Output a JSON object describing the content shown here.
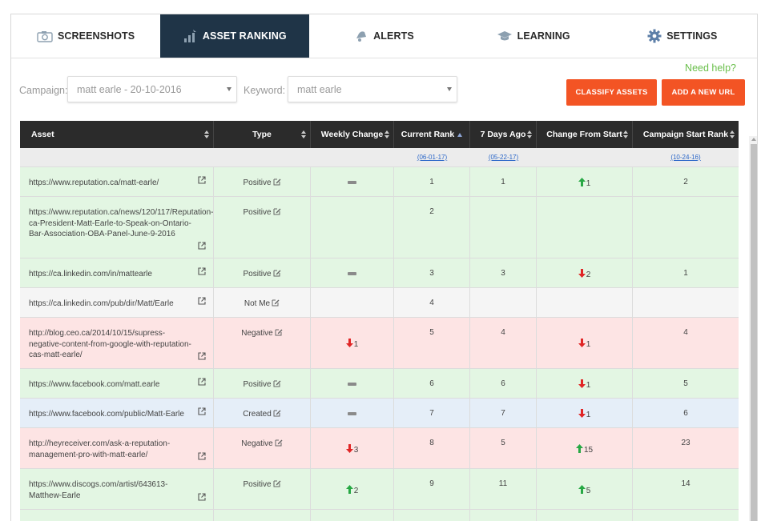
{
  "tabs": [
    {
      "label": "SCREENSHOTS",
      "icon": "camera-icon",
      "active": false
    },
    {
      "label": "ASSET RANKING",
      "icon": "bar-chart-icon",
      "active": true
    },
    {
      "label": "ALERTS",
      "icon": "bell-icon",
      "active": false
    },
    {
      "label": "LEARNING",
      "icon": "graduation-cap-icon",
      "active": false
    },
    {
      "label": "SETTINGS",
      "icon": "gear-icon",
      "active": false
    }
  ],
  "help": "Need help?",
  "filters": {
    "campaign_label": "Campaign:",
    "campaign_value": "matt earle - 20-10-2016",
    "keyword_label": "Keyword:",
    "keyword_value": "matt earle"
  },
  "buttons": {
    "classify": "CLASSIFY ASSETS",
    "add_url": "ADD A NEW URL"
  },
  "colors": {
    "accent": "#f35424",
    "nav_active": "#1f3447",
    "positive_row": "#e3f6e3",
    "negative_row": "#fde4e4",
    "neutral_row": "#f5f5f5",
    "created_row": "#e5eef8",
    "up_arrow": "#27a844",
    "down_arrow": "#e02626"
  },
  "table": {
    "headers": {
      "asset": "Asset",
      "type": "Type",
      "weekly": "Weekly Change",
      "current": "Current Rank",
      "seven": "7 Days Ago",
      "change_start": "Change From Start",
      "start_rank": "Campaign Start Rank"
    },
    "dates": {
      "current": "(06-01-17)",
      "seven": "(05-22-17)",
      "start": "(10-24-16)"
    },
    "rows": [
      {
        "url": "https://www.reputation.ca/matt-earle/",
        "type": "Positive",
        "cls": "positive",
        "h": 37,
        "weekly": {
          "kind": "dash"
        },
        "current": "1",
        "seven": "1",
        "change": {
          "kind": "up",
          "value": "1"
        },
        "start": "2"
      },
      {
        "url": "https://www.reputation.ca/news/120/117/Reputation-ca-President-Matt-Earle-to-Speak-on-Ontario-Bar-Association-OBA-Panel-June-9-2016",
        "type": "Positive",
        "cls": "positive",
        "h": 77,
        "weekly": {
          "kind": "none"
        },
        "current": "2",
        "seven": "",
        "change": {
          "kind": "none"
        },
        "start": ""
      },
      {
        "url": "https://ca.linkedin.com/in/mattearle",
        "type": "Positive",
        "cls": "positive",
        "h": 37,
        "weekly": {
          "kind": "dash"
        },
        "current": "3",
        "seven": "3",
        "change": {
          "kind": "down",
          "value": "2"
        },
        "start": "1"
      },
      {
        "url": "https://ca.linkedin.com/pub/dir/Matt/Earle",
        "type": "Not Me",
        "cls": "neutral",
        "h": 37,
        "weekly": {
          "kind": "none"
        },
        "current": "4",
        "seven": "",
        "change": {
          "kind": "none"
        },
        "start": ""
      },
      {
        "url": "http://blog.ceo.ca/2014/10/15/supress-negative-content-from-google-with-reputation-cas-matt-earle/",
        "type": "Negative",
        "cls": "negative",
        "h": 64,
        "weekly": {
          "kind": "down",
          "value": "1"
        },
        "current": "5",
        "seven": "4",
        "change": {
          "kind": "down",
          "value": "1"
        },
        "start": "4"
      },
      {
        "url": "https://www.facebook.com/matt.earle",
        "type": "Positive",
        "cls": "positive",
        "h": 37,
        "weekly": {
          "kind": "dash"
        },
        "current": "6",
        "seven": "6",
        "change": {
          "kind": "down",
          "value": "1"
        },
        "start": "5"
      },
      {
        "url": "https://www.facebook.com/public/Matt-Earle",
        "type": "Created",
        "cls": "created",
        "h": 37,
        "weekly": {
          "kind": "dash"
        },
        "current": "7",
        "seven": "7",
        "change": {
          "kind": "down",
          "value": "1"
        },
        "start": "6"
      },
      {
        "url": "http://heyreceiver.com/ask-a-reputation-management-pro-with-matt-earle/",
        "type": "Negative",
        "cls": "negative",
        "h": 51,
        "weekly": {
          "kind": "down",
          "value": "3"
        },
        "current": "8",
        "seven": "5",
        "change": {
          "kind": "up",
          "value": "15"
        },
        "start": "23"
      },
      {
        "url": "https://www.discogs.com/artist/643613-Matthew-Earle",
        "type": "Positive",
        "cls": "positive",
        "h": 51,
        "weekly": {
          "kind": "up",
          "value": "2"
        },
        "current": "9",
        "seven": "11",
        "change": {
          "kind": "up",
          "value": "5"
        },
        "start": "14"
      },
      {
        "url": "",
        "type": "",
        "cls": "positive",
        "h": 30,
        "weekly": {
          "kind": "none"
        },
        "current": "",
        "seven": "",
        "change": {
          "kind": "none"
        },
        "start": ""
      }
    ]
  }
}
